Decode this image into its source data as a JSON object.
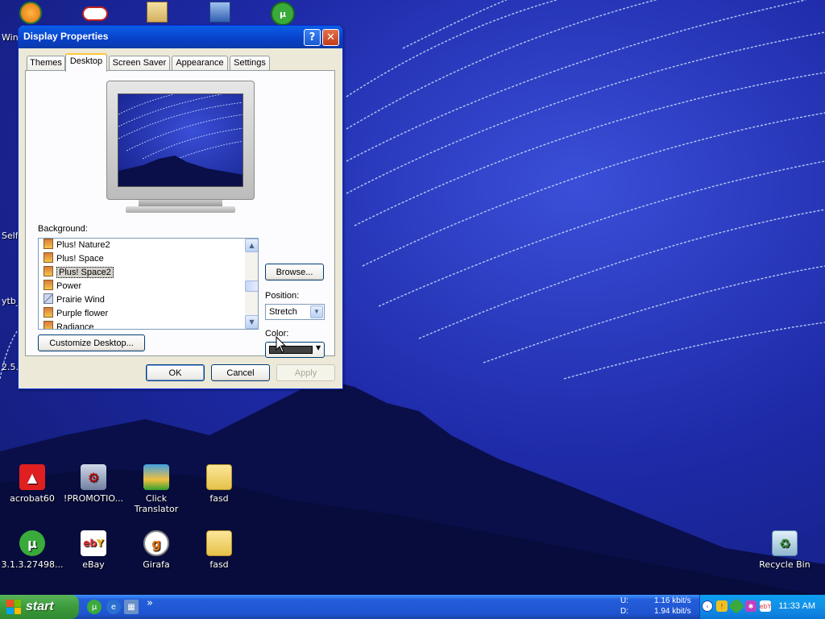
{
  "window": {
    "title": "Display Properties",
    "help_glyph": "?",
    "close_glyph": "✕",
    "tabs": [
      {
        "label": "Themes"
      },
      {
        "label": "Desktop"
      },
      {
        "label": "Screen Saver"
      },
      {
        "label": "Appearance"
      },
      {
        "label": "Settings"
      }
    ],
    "active_tab": "Desktop",
    "background_label": "Background:",
    "background_items": [
      {
        "label": "Plus! Nature2",
        "icon": "image-file-icon"
      },
      {
        "label": "Plus! Space",
        "icon": "image-file-icon"
      },
      {
        "label": "Plus! Space2",
        "icon": "image-file-icon",
        "selected": true
      },
      {
        "label": "Power",
        "icon": "image-file-icon"
      },
      {
        "label": "Prairie Wind",
        "icon": "ruler-file-icon"
      },
      {
        "label": "Purple flower",
        "icon": "image-file-icon"
      },
      {
        "label": "Radiance",
        "icon": "image-file-icon"
      }
    ],
    "browse_label": "Browse...",
    "position_label": "Position:",
    "position_value": "Stretch",
    "color_label": "Color:",
    "color_value": "#404040",
    "customize_label": "Customize Desktop...",
    "ok_label": "OK",
    "cancel_label": "Cancel",
    "apply_label": "Apply"
  },
  "desktop": {
    "edge_labels": [
      "Wind",
      "Selft",
      "ytb_",
      "2.5."
    ],
    "icons": [
      {
        "label": "acrobat60",
        "icon": "acrobat-icon"
      },
      {
        "label": "!PROMOTIO...",
        "icon": "installer-icon"
      },
      {
        "label": "Click Translator",
        "icon": "translator-icon"
      },
      {
        "label": "fasd",
        "icon": "zip-folder-icon"
      },
      {
        "label": "3.1.3.27498...",
        "icon": "utorrent-icon"
      },
      {
        "label": "eBay",
        "icon": "ebay-icon"
      },
      {
        "label": "Girafa",
        "icon": "girafa-icon"
      },
      {
        "label": "fasd",
        "icon": "folder-icon"
      },
      {
        "label": "Recycle Bin",
        "icon": "recycle-bin-icon"
      }
    ]
  },
  "taskbar": {
    "start_label": "start",
    "chevron": "»",
    "upload_label": "U:",
    "upload_speed": "1.16 kbit/s",
    "download_label": "D:",
    "download_speed": "1.94 kbit/s",
    "clock": "11:33 AM",
    "tray_ebay": "ebY"
  },
  "colors": {
    "accent": "#0a5fe8",
    "start_green": "#3c9b3c",
    "wallpaper": "#1e2aa8"
  }
}
